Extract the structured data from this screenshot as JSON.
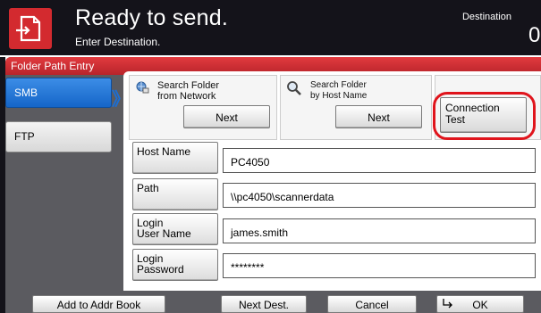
{
  "header": {
    "title": "Ready to send.",
    "subtitle": "Enter Destination.",
    "destination_label": "Destination",
    "destination_count": "0"
  },
  "panel": {
    "title": "Folder Path Entry"
  },
  "tabs": [
    {
      "label": "SMB",
      "selected": true
    },
    {
      "label": "FTP",
      "selected": false
    }
  ],
  "search": {
    "network": {
      "line1": "Search Folder",
      "line2": "from Network",
      "button": "Next"
    },
    "host": {
      "line1": "Search Folder",
      "line2": "by Host Name",
      "button": "Next"
    },
    "connection_test": {
      "line1": "Connection",
      "line2": "Test"
    }
  },
  "fields": [
    {
      "label_line1": "Host Name",
      "label_line2": "",
      "value": "PC4050"
    },
    {
      "label_line1": "Path",
      "label_line2": "",
      "value": "\\\\pc4050\\scannerdata"
    },
    {
      "label_line1": "Login",
      "label_line2": "User Name",
      "value": "james.smith"
    },
    {
      "label_line1": "Login",
      "label_line2": "Password",
      "value": "********"
    }
  ],
  "footer": {
    "add_to_addr_book": "Add to Addr Book",
    "next_dest": "Next Dest.",
    "cancel": "Cancel",
    "ok": "OK"
  },
  "colors": {
    "header_bg": "#14131a",
    "accent_red": "#d32a2f",
    "selected_tab_blue": "#1565c8",
    "highlight_ring": "#e0141c"
  }
}
